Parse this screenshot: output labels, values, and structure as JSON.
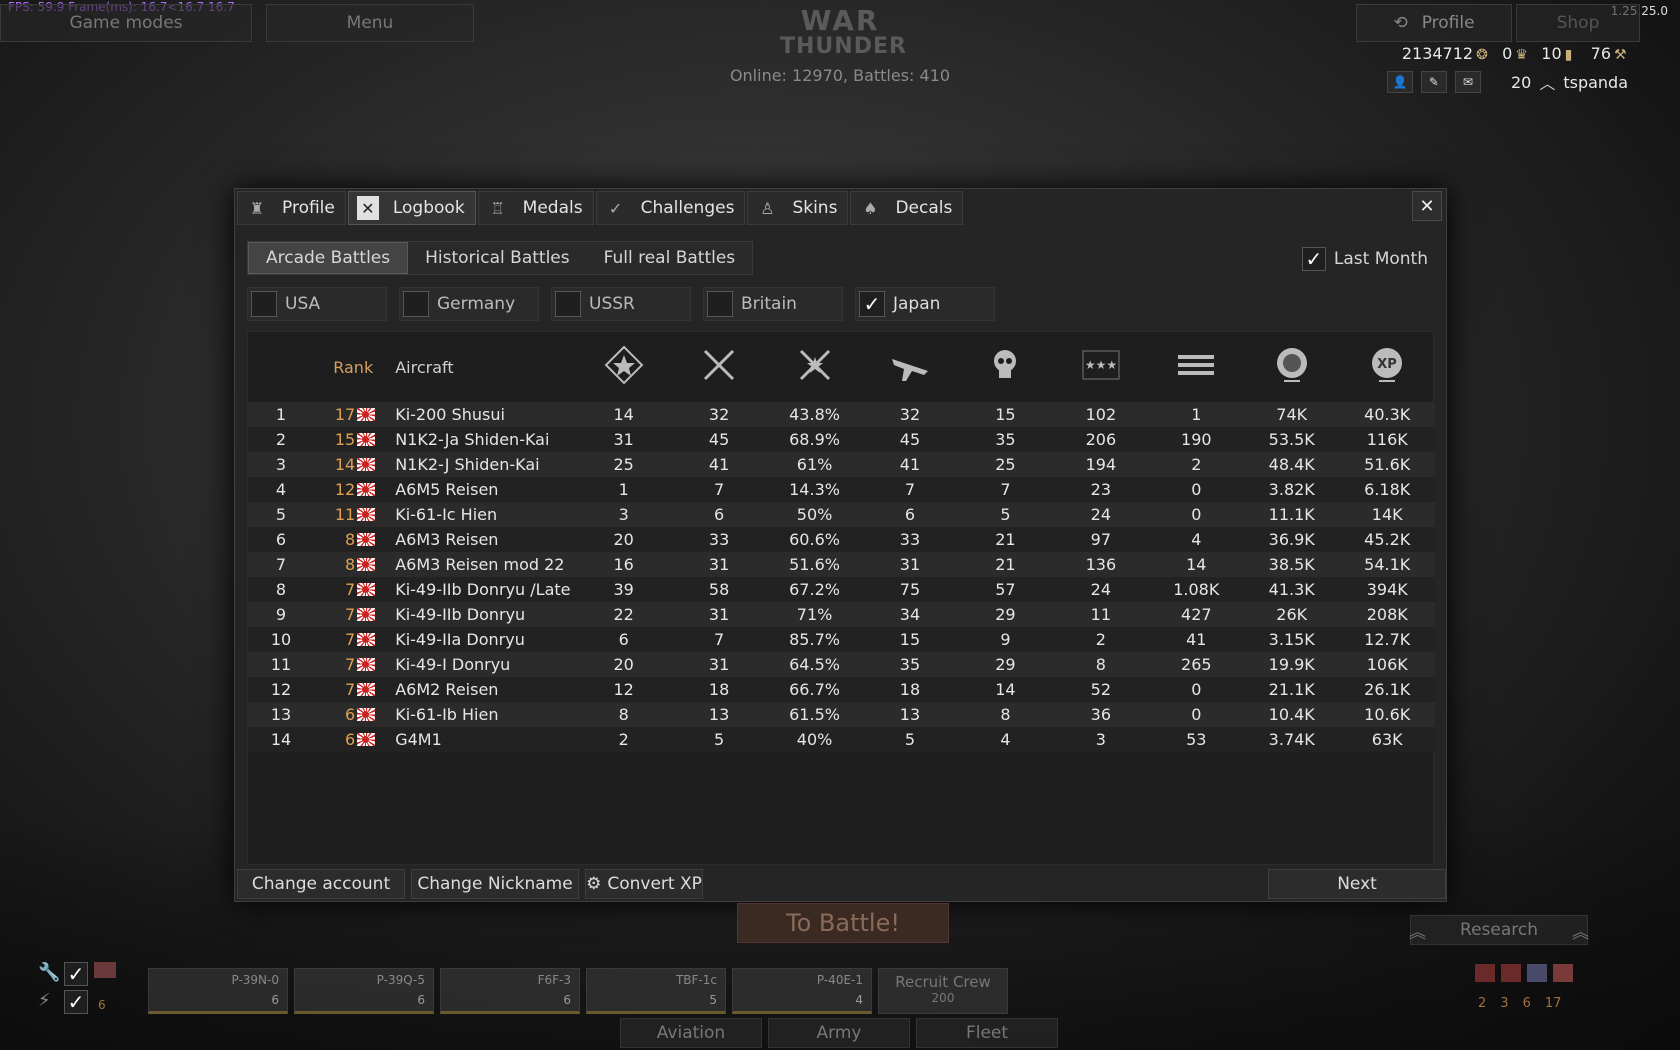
{
  "hud": {
    "fps": "FPS: 59.9 Frame(ms): 16.7<16.7 16.7",
    "version": "1.25.25.0",
    "game_modes": "Game modes",
    "menu": "Menu",
    "profile": "Profile",
    "shop": "Shop",
    "logo_line1": "WAR",
    "logo_line2": "THUNDER",
    "online": "Online: 12970, Battles: 410",
    "silver_lions": "2134712",
    "golden_eagles": "0",
    "stat3": "10",
    "stat4": "76",
    "level": "20",
    "username": "tspanda"
  },
  "dialog": {
    "tabs": [
      {
        "label": "Profile",
        "icon": "profile-icon"
      },
      {
        "label": "Logbook",
        "icon": "logbook-icon"
      },
      {
        "label": "Medals",
        "icon": "medal-icon"
      },
      {
        "label": "Challenges",
        "icon": "challenges-icon"
      },
      {
        "label": "Skins",
        "icon": "skins-icon"
      },
      {
        "label": "Decals",
        "icon": "decals-icon"
      }
    ],
    "active_tab": "Logbook",
    "close": "✕",
    "modes": [
      "Arcade Battles",
      "Historical Battles",
      "Full real Battles"
    ],
    "active_mode": "Arcade Battles",
    "last_month": {
      "label": "Last Month",
      "checked": true
    },
    "countries": [
      {
        "label": "USA",
        "checked": false
      },
      {
        "label": "Germany",
        "checked": false
      },
      {
        "label": "USSR",
        "checked": false
      },
      {
        "label": "Britain",
        "checked": false
      },
      {
        "label": "Japan",
        "checked": true
      }
    ],
    "table": {
      "headers": {
        "rank": "Rank",
        "aircraft": "Aircraft"
      },
      "stat_icons": [
        "victories-icon",
        "battles-icon",
        "win-ratio-icon",
        "flights-icon",
        "deaths-icon",
        "air-kills-icon",
        "ground-kills-icon",
        "silver-lions-icon",
        "xp-icon"
      ],
      "rows": [
        [
          "1",
          "17",
          "Ki-200 Shusui",
          "14",
          "32",
          "43.8%",
          "32",
          "15",
          "102",
          "1",
          "74K",
          "40.3K"
        ],
        [
          "2",
          "15",
          "N1K2-Ja Shiden-Kai",
          "31",
          "45",
          "68.9%",
          "45",
          "35",
          "206",
          "190",
          "53.5K",
          "116K"
        ],
        [
          "3",
          "14",
          "N1K2-J Shiden-Kai",
          "25",
          "41",
          "61%",
          "41",
          "25",
          "194",
          "2",
          "48.4K",
          "51.6K"
        ],
        [
          "4",
          "12",
          "A6M5 Reisen",
          "1",
          "7",
          "14.3%",
          "7",
          "7",
          "23",
          "0",
          "3.82K",
          "6.18K"
        ],
        [
          "5",
          "11",
          "Ki-61-Ic Hien",
          "3",
          "6",
          "50%",
          "6",
          "5",
          "24",
          "0",
          "11.1K",
          "14K"
        ],
        [
          "6",
          "8",
          "A6M3 Reisen",
          "20",
          "33",
          "60.6%",
          "33",
          "21",
          "97",
          "4",
          "36.9K",
          "45.2K"
        ],
        [
          "7",
          "8",
          "A6M3 Reisen mod 22",
          "16",
          "31",
          "51.6%",
          "31",
          "21",
          "136",
          "14",
          "38.5K",
          "54.1K"
        ],
        [
          "8",
          "7",
          "Ki-49-IIb Donryu /Late",
          "39",
          "58",
          "67.2%",
          "75",
          "57",
          "24",
          "1.08K",
          "41.3K",
          "394K"
        ],
        [
          "9",
          "7",
          "Ki-49-IIb Donryu",
          "22",
          "31",
          "71%",
          "34",
          "29",
          "11",
          "427",
          "26K",
          "208K"
        ],
        [
          "10",
          "7",
          "Ki-49-IIa Donryu",
          "6",
          "7",
          "85.7%",
          "15",
          "9",
          "2",
          "41",
          "3.15K",
          "12.7K"
        ],
        [
          "11",
          "7",
          "Ki-49-I Donryu",
          "20",
          "31",
          "64.5%",
          "35",
          "29",
          "8",
          "265",
          "19.9K",
          "106K"
        ],
        [
          "12",
          "7",
          "A6M2 Reisen",
          "12",
          "18",
          "66.7%",
          "18",
          "14",
          "52",
          "0",
          "21.1K",
          "26.1K"
        ],
        [
          "13",
          "6",
          "Ki-61-Ib Hien",
          "8",
          "13",
          "61.5%",
          "13",
          "8",
          "36",
          "0",
          "10.4K",
          "10.6K"
        ],
        [
          "14",
          "6",
          "G4M1",
          "2",
          "5",
          "40%",
          "5",
          "4",
          "3",
          "53",
          "3.74K",
          "63K"
        ]
      ]
    },
    "footer": {
      "change_account": "Change account",
      "change_nickname": "Change Nickname",
      "convert_xp": "Convert XP",
      "next": "Next"
    }
  },
  "bottom": {
    "to_battle": "To Battle!",
    "research": "Research",
    "recruit_crew": "Recruit Crew",
    "recruit_cost": "200",
    "nav": [
      "Aviation",
      "Army",
      "Fleet"
    ],
    "slots": [
      {
        "name": "P-39N-0",
        "rank": "6"
      },
      {
        "name": "P-39Q-5",
        "rank": "6"
      },
      {
        "name": "F6F-3",
        "rank": "6"
      },
      {
        "name": "TBF-1c",
        "rank": "5"
      },
      {
        "name": "P-40E-1",
        "rank": "4"
      }
    ],
    "country_counts": [
      "2",
      "3",
      "6",
      "17"
    ],
    "left_rank": "6"
  }
}
